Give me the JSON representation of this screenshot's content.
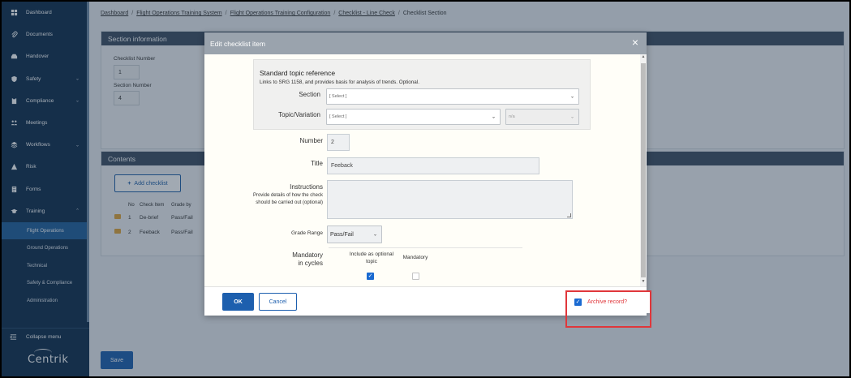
{
  "sidebar": {
    "items": [
      {
        "label": "Dashboard",
        "icon": "dashboard-icon"
      },
      {
        "label": "Documents",
        "icon": "paperclip-icon"
      },
      {
        "label": "Handover",
        "icon": "inbox-icon"
      },
      {
        "label": "Safety",
        "icon": "shield-icon",
        "chevron": "⌄"
      },
      {
        "label": "Compliance",
        "icon": "clipboard-icon",
        "chevron": "⌄"
      },
      {
        "label": "Meetings",
        "icon": "people-icon"
      },
      {
        "label": "Workflows",
        "icon": "layers-icon",
        "chevron": "⌄"
      },
      {
        "label": "Risk",
        "icon": "warning-icon"
      },
      {
        "label": "Forms",
        "icon": "form-icon"
      },
      {
        "label": "Training",
        "icon": "graduation-cap-icon",
        "chevron": "⌃"
      }
    ],
    "training_sub": [
      "Flight Operations",
      "Ground Operations",
      "Technical",
      "Safety & Compliance",
      "Administration"
    ],
    "collapse_label": "Collapse menu",
    "logo": "Centrik"
  },
  "breadcrumb": {
    "items": [
      "Dashboard",
      "Flight Operations Training System",
      "Flight Operations Training Configuration",
      "Checklist - Line Check"
    ],
    "current": "Checklist Section",
    "sep": "/"
  },
  "section_info": {
    "title": "Section information",
    "checklist_number_label": "Checklist Number",
    "checklist_number": "1",
    "section_number_label": "Section Number",
    "section_number": "4"
  },
  "contents": {
    "title": "Contents",
    "add_label": "Add checklist",
    "headers": [
      "No",
      "Check Item",
      "Grade by"
    ],
    "rows": [
      {
        "no": "1",
        "item": "De-brief",
        "grade": "Pass/Fail"
      },
      {
        "no": "2",
        "item": "Feeback",
        "grade": "Pass/Fail"
      }
    ]
  },
  "save_label": "Save",
  "modal": {
    "title": "Edit checklist item",
    "close": "×",
    "std_title": "Standard topic reference",
    "std_sub": "Links to SRG 1158, and provides basis for analysis of trends. Optional.",
    "section_label": "Section",
    "section_value": "[ Select ]",
    "topic_label": "Topic/Variation",
    "topic_value": "[ Select ]",
    "variation_value": "n/a",
    "number_label": "Number",
    "number_value": "2",
    "title_label": "Title",
    "title_value": "Feeback",
    "instructions_label": "Instructions",
    "instructions_help": "Provide details of how the check should be carried out (optional)",
    "grade_label": "Grade Range",
    "grade_value": "Pass/Fail",
    "mandatory_label_1": "Mandatory",
    "mandatory_label_2": "in cycles",
    "col_optional": "Include as optional topic",
    "col_mandatory": "Mandatory",
    "ok_label": "OK",
    "cancel_label": "Cancel",
    "archive_label": "Archive record?"
  }
}
